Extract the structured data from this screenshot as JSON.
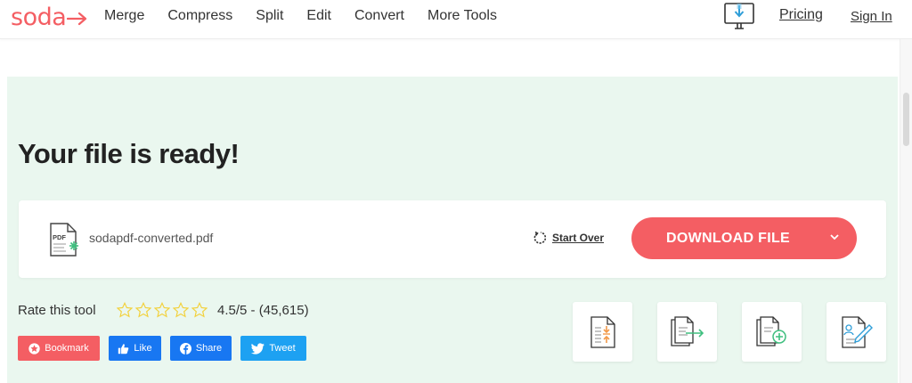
{
  "header": {
    "logo_text": "soda",
    "nav": [
      "Merge",
      "Compress",
      "Split",
      "Edit",
      "Convert",
      "More Tools"
    ],
    "pricing": "Pricing",
    "sign_in": "Sign In",
    "download_app_icon": "monitor-download-icon"
  },
  "main": {
    "title": "Your file is ready!",
    "file": {
      "icon": "pdf-file-icon",
      "name": "sodapdf-converted.pdf"
    },
    "start_over": "Start Over",
    "download_label": "DOWNLOAD FILE",
    "rating": {
      "label": "Rate this tool",
      "stars_total": 5,
      "stars_filled": 0,
      "score_text": "4.5/5 - (45,615)"
    },
    "social": {
      "bookmark": "Bookmark",
      "like": "Like",
      "share": "Share",
      "tweet": "Tweet"
    },
    "tools": [
      "compress-tool-icon",
      "convert-tool-icon",
      "merge-add-tool-icon",
      "edit-tool-icon"
    ]
  },
  "colors": {
    "brand": "#f45e63",
    "panel_bg": "#eaf7ef",
    "facebook": "#1877f2",
    "twitter": "#1da1f2",
    "star_outline": "#f2d13c",
    "tool_accent": "#f29a4a",
    "tool_green": "#3fbf7f"
  }
}
